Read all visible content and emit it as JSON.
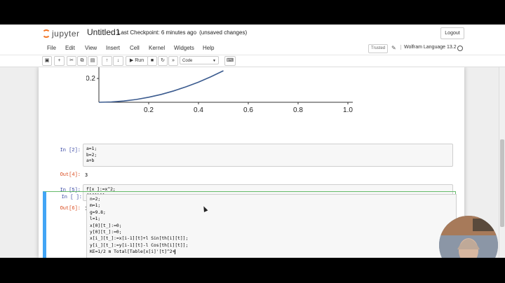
{
  "header": {
    "logo_text": "jupyter",
    "notebook_title": "Untitled1",
    "checkpoint": "Last Checkpoint: 6 minutes ago",
    "unsaved": "(unsaved changes)",
    "logout": "Logout"
  },
  "menu": {
    "items": [
      "File",
      "Edit",
      "View",
      "Insert",
      "Cell",
      "Kernel",
      "Widgets",
      "Help"
    ],
    "trusted": "Trusted",
    "kernel_name": "Wolfram Language 13.2"
  },
  "toolbar": {
    "run_label": "Run",
    "cell_type": "Code"
  },
  "chart_data": {
    "type": "line",
    "x_ticks": [
      "0.2",
      "0.4",
      "0.6",
      "0.8",
      "1.0"
    ],
    "y_ticks": [
      "0.2"
    ],
    "xlim": [
      0,
      1.0
    ],
    "ylim": [
      0,
      0.25
    ],
    "series": [
      {
        "function": "x^2",
        "x": [
          0,
          0.05,
          0.1,
          0.15,
          0.2,
          0.25,
          0.3,
          0.35,
          0.4,
          0.45,
          0.5
        ],
        "y": [
          0,
          0.0025,
          0.01,
          0.0225,
          0.04,
          0.0625,
          0.09,
          0.1225,
          0.16,
          0.2025,
          0.25
        ]
      }
    ],
    "line_color": "#3b5b8f"
  },
  "cells": [
    {
      "prompt": "In [2]:",
      "code": "a=1;\nb=2;\na+b",
      "out_prompt": "Out[4]:",
      "output": "3"
    },
    {
      "prompt": "In [5]:",
      "code": "f[x_]:=x^2;\nf[f[2]]",
      "out_prompt": "Out[6]:",
      "output": "16"
    },
    {
      "prompt": "In [ ]:",
      "code": "n=2;\nm=1;\ng=9.8;\nl=1;\nx[0][t_]:=0;\ny[0][t_]:=0;\nx[i_][t_]:=x[i-1][t]+l Sin[th[i][t]];\ny[i_][t_]:=y[i-1][t]-l Cos[th[i][t]];\nKE=1/2 m Total[Table[x[i]'[t]^2+"
    }
  ]
}
